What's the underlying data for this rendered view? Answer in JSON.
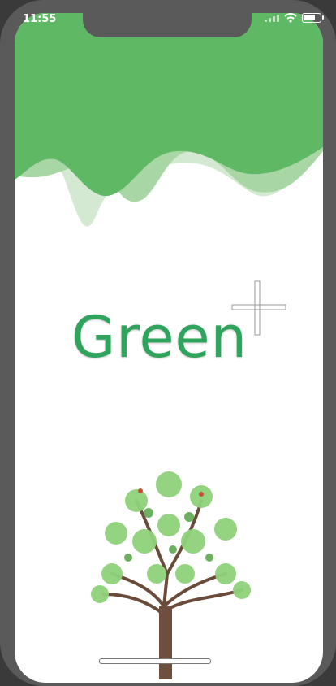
{
  "status_bar": {
    "time": "11:55",
    "icons": [
      "signal-icon",
      "wifi-icon",
      "battery-icon"
    ]
  },
  "app": {
    "brand_name": "Green",
    "brand_mark": "plus-icon",
    "illustration": "tree-icon"
  },
  "colors": {
    "primary_green": "#5eb864",
    "light_green": "#a9d6a5",
    "pale_green": "#d3e9d1",
    "brand_text": "#2fa45d",
    "background": "#ffffff"
  }
}
